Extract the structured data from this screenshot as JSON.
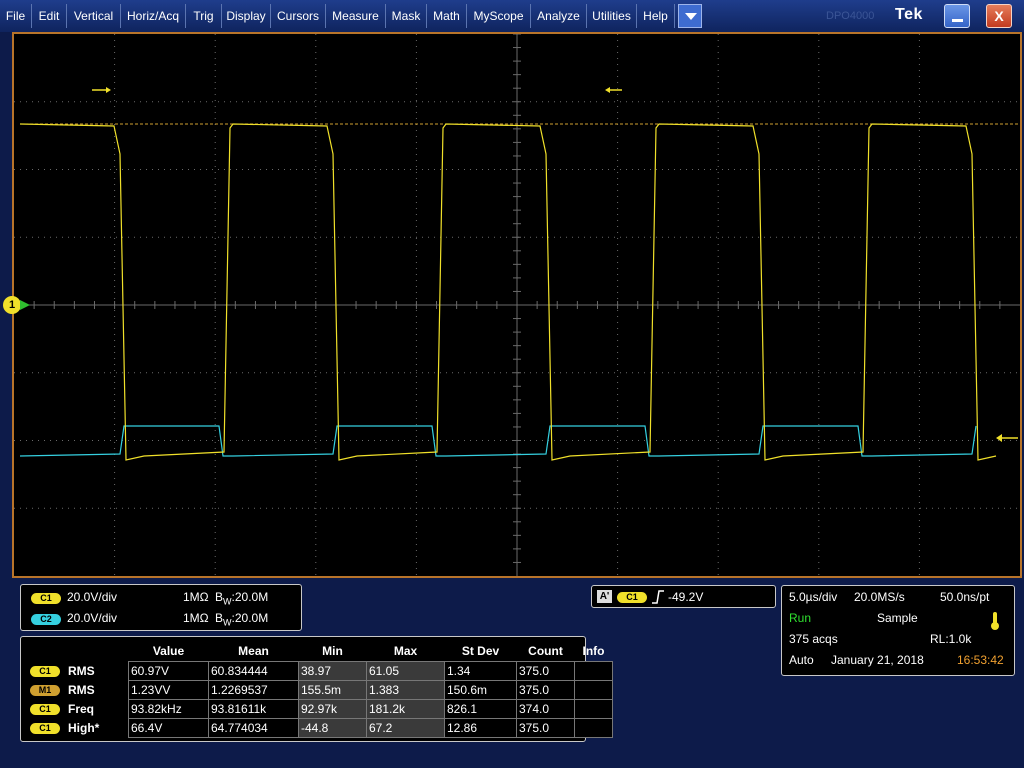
{
  "menu": [
    "File",
    "Edit",
    "Vertical",
    "Horiz/Acq",
    "Trig",
    "Display",
    "Cursors",
    "Measure",
    "Mask",
    "Math",
    "MyScope",
    "Analyze",
    "Utilities",
    "Help"
  ],
  "brand": "Tek",
  "brand_ghost": "DPO4000",
  "window_buttons": {
    "minimize": "minimize-button",
    "close_label": "X"
  },
  "icons": {
    "dropdown": "chevron-down-icon",
    "ch1_marker": "channel-1-ground-marker-icon",
    "trigger_level": "trigger-level-arrow-icon",
    "trigger_pos": "trigger-position-arrow-icon",
    "armed": "thermometer-icon"
  },
  "colors": {
    "ch1": "#f0e02a",
    "ch2": "#35d0e0",
    "math": "#d0a030",
    "grid": "#6a6a6a",
    "frame": "#b8742a"
  },
  "channel1_marker": "1",
  "vertical_panel": [
    {
      "ch": "C1",
      "scale": "20.0V/div",
      "coupling": "1MΩ",
      "bw_b": "B",
      "bw_w": "W",
      "bw_val": ":20.0M"
    },
    {
      "ch": "C2",
      "scale": "20.0V/div",
      "coupling": "1MΩ",
      "bw_b": "B",
      "bw_w": "W",
      "bw_val": ":20.0M"
    }
  ],
  "trigger_panel": {
    "mode_tag": "A'",
    "source": "C1",
    "slope_icon": "rising-edge-icon",
    "level": "-49.2V"
  },
  "horizontal_panel": {
    "timebase": "5.0µs/div",
    "sample_rate": "20.0MS/s",
    "resolution": "50.0ns/pt",
    "run_state": "Run",
    "acq_mode": "Sample",
    "acqs": "375 acqs",
    "record_length": "RL:1.0k",
    "trigger_mode": "Auto",
    "date": "January 21, 2018",
    "time": "16:53:42"
  },
  "measurements": {
    "headers": [
      "Value",
      "Mean",
      "Min",
      "Max",
      "St Dev",
      "Count",
      "Info"
    ],
    "rows": [
      {
        "src": "C1",
        "name": "RMS",
        "value": "60.97V",
        "mean": "60.834444",
        "min": "38.97",
        "max": "61.05",
        "stdev": "1.34",
        "count": "375.0",
        "info": ""
      },
      {
        "src": "M1",
        "name": "RMS",
        "value": "1.23VV",
        "mean": "1.2269537",
        "min": "155.5m",
        "max": "1.383",
        "stdev": "150.6m",
        "count": "375.0",
        "info": ""
      },
      {
        "src": "C1",
        "name": "Freq",
        "value": "93.82kHz",
        "mean": "93.81611k",
        "min": "92.97k",
        "max": "181.2k",
        "stdev": "826.1",
        "count": "374.0",
        "info": ""
      },
      {
        "src": "C1",
        "name": "High*",
        "value": "66.4V",
        "mean": "64.774034",
        "min": "-44.8",
        "max": "67.2",
        "stdev": "12.86",
        "count": "375.0",
        "info": ""
      }
    ]
  }
}
